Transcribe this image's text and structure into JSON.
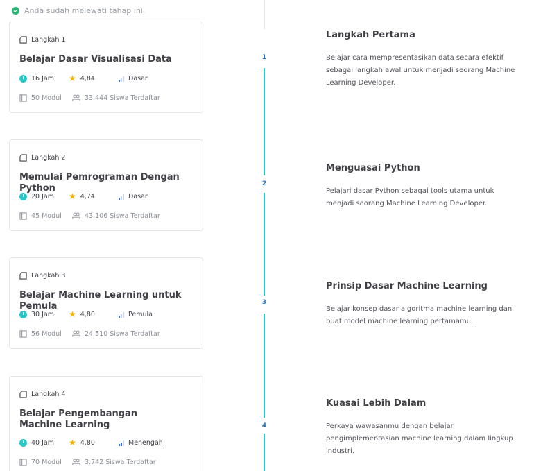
{
  "notice": {
    "text": "Anda sudah melewati tahap ini."
  },
  "steps": [
    {
      "step_label": "Langkah 1",
      "title": "Belajar Dasar Visualisasi Data",
      "hours": "16 Jam",
      "rating": "4,84",
      "level": "Dasar",
      "level_bars": 1,
      "modules": "50 Modul",
      "students": "33.444 Siswa Terdaftar",
      "number": "1",
      "heading": "Langkah Pertama",
      "description": "Belajar cara mempresentasikan data secara efektif sebagai langkah awal untuk menjadi seorang Machine Learning Developer."
    },
    {
      "step_label": "Langkah 2",
      "title": "Memulai Pemrograman Dengan Python",
      "hours": "20 Jam",
      "rating": "4,74",
      "level": "Dasar",
      "level_bars": 1,
      "modules": "45 Modul",
      "students": "43.106 Siswa Terdaftar",
      "number": "2",
      "heading": "Menguasai Python",
      "description": "Pelajari dasar Python sebagai tools utama untuk menjadi seorang Machine Learning Developer."
    },
    {
      "step_label": "Langkah 3",
      "title": "Belajar Machine Learning untuk Pemula",
      "hours": "30 Jam",
      "rating": "4,80",
      "level": "Pemula",
      "level_bars": 1,
      "modules": "56 Modul",
      "students": "24.510 Siswa Terdaftar",
      "number": "3",
      "heading": "Prinsip Dasar Machine Learning",
      "description": "Belajar konsep dasar algoritma machine learning dan buat model machine learning pertamamu."
    },
    {
      "step_label": "Langkah 4",
      "title": "Belajar Pengembangan Machine Learning",
      "hours": "40 Jam",
      "rating": "4,80",
      "level": "Menengah",
      "level_bars": 2,
      "modules": "70 Modul",
      "students": "3.742 Siswa Terdaftar",
      "number": "4",
      "heading": "Kuasai Lebih Dalam",
      "description": "Perkaya wawasanmu dengan belajar pengimplementasian machine learning dalam lingkup industri."
    }
  ],
  "colors": {
    "accent": "#26c6c6",
    "star": "#f4b400",
    "level_bar": "#2f6fe4",
    "check": "#2bb673",
    "step_number": "#1a73c9"
  }
}
